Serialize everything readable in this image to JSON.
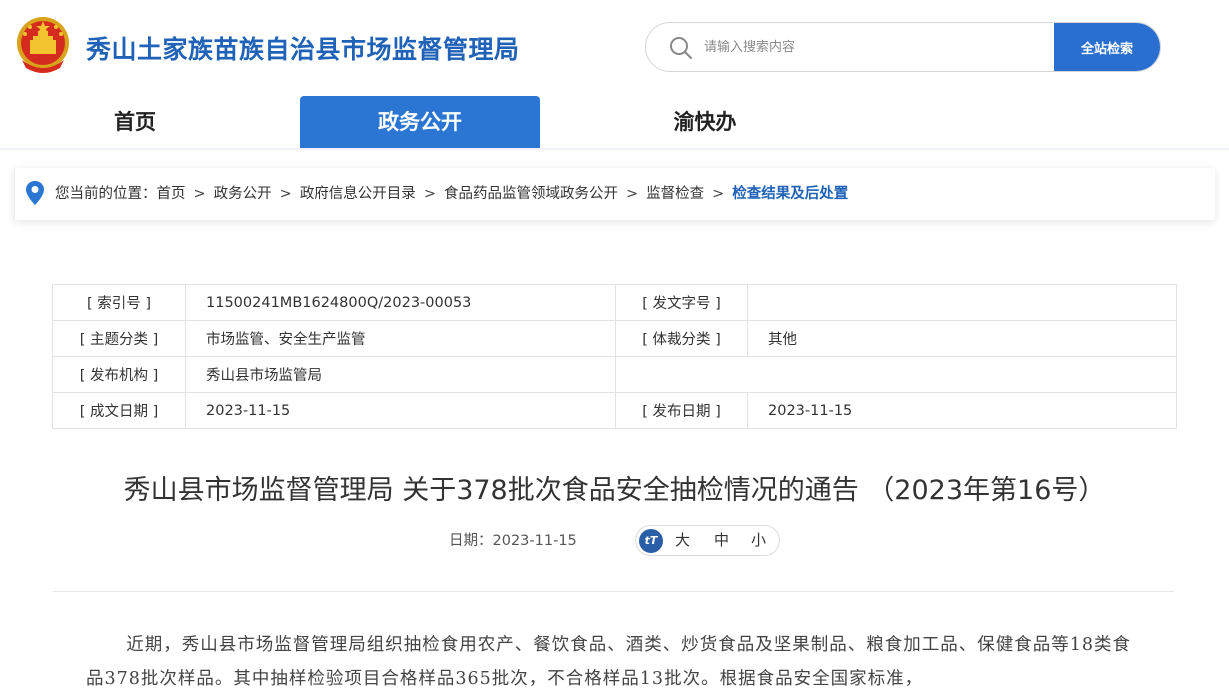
{
  "header": {
    "site_title": "秀山土家族苗族自治县市场监督管理局",
    "search_placeholder": "请输入搜索内容",
    "search_button": "全站检索"
  },
  "nav": {
    "items": [
      {
        "label": "首页"
      },
      {
        "label": "政务公开",
        "active": true
      },
      {
        "label": "渝快办"
      }
    ]
  },
  "breadcrumb": {
    "prefix": "您当前的位置：",
    "items": [
      "首页",
      "政务公开",
      "政府信息公开目录",
      "食品药品监管领域政务公开",
      "监督检查"
    ],
    "separator": ">",
    "current": "检查结果及后处置"
  },
  "meta": {
    "index_label": "[ 索引号 ]",
    "index_value": "11500241MB1624800Q/2023-00053",
    "doc_no_label": "[ 发文字号 ]",
    "doc_no_value": "",
    "topic_label": "[ 主题分类 ]",
    "topic_value": "市场监管、安全生产监管",
    "genre_label": "[ 体裁分类 ]",
    "genre_value": "其他",
    "publisher_label": "[ 发布机构 ]",
    "publisher_value": "秀山县市场监管局",
    "created_label": "[ 成文日期 ]",
    "created_value": "2023-11-15",
    "published_label": "[ 发布日期 ]",
    "published_value": "2023-11-15"
  },
  "article": {
    "title": "秀山县市场监督管理局 关于378批次食品安全抽检情况的通告 （2023年第16号）",
    "date_label": "日期：",
    "date_value": "2023-11-15",
    "font_icon": "tT",
    "font_large": "大",
    "font_medium": "中",
    "font_small": "小",
    "body": "近期，秀山县市场监督管理局组织抽检食用农产、餐饮食品、酒类、炒货食品及坚果制品、粮食加工品、保健食品等18类食品378批次样品。其中抽样检验项目合格样品365批次，不合格样品13批次。根据食品安全国家标准，"
  },
  "colors": {
    "brand_blue": "#1f62b7",
    "nav_active": "#2a76d2",
    "search_button": "#2a6fcf"
  }
}
